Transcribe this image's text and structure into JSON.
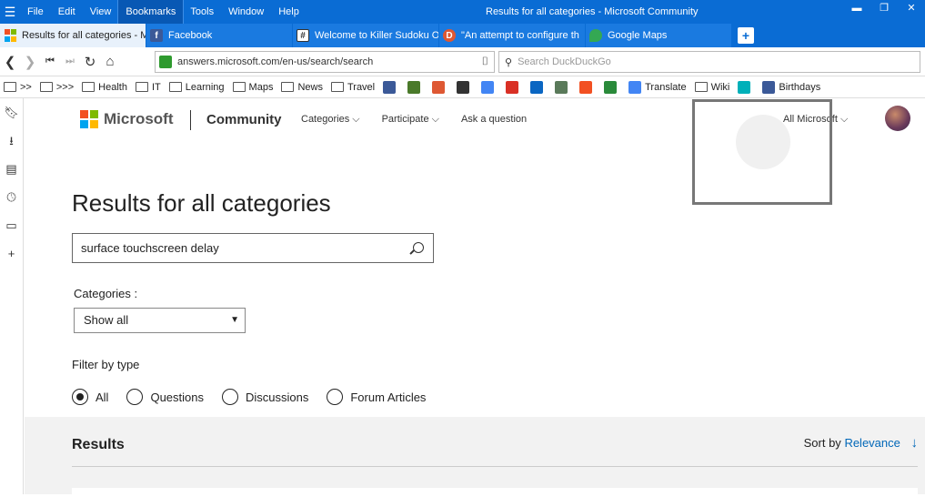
{
  "titlebar": {
    "menu": [
      "File",
      "Edit",
      "View",
      "Bookmarks",
      "Tools",
      "Window",
      "Help"
    ],
    "active_menu": "Bookmarks",
    "window_title": "Results for all categories - Microsoft Community"
  },
  "tabs": [
    {
      "label": "Results for all categories - M",
      "icon": "microsoft-icon",
      "active": true
    },
    {
      "label": "Facebook",
      "icon": "facebook-icon",
      "active": false
    },
    {
      "label": "Welcome to Killer Sudoku O",
      "icon": "sudoku-icon",
      "active": false
    },
    {
      "label": "\"An attempt to configure th",
      "icon": "duckduckgo-icon",
      "active": false
    },
    {
      "label": "Google Maps",
      "icon": "google-maps-icon",
      "active": false
    }
  ],
  "nav": {
    "url": "answers.microsoft.com/en-us/search/search",
    "search_placeholder": "Search DuckDuckGo"
  },
  "bookmarks": [
    {
      "label": ">>",
      "type": "folder"
    },
    {
      "label": ">>>",
      "type": "folder"
    },
    {
      "label": "Health",
      "type": "folder"
    },
    {
      "label": "IT",
      "type": "folder"
    },
    {
      "label": "Learning",
      "type": "folder"
    },
    {
      "label": "Maps",
      "type": "folder"
    },
    {
      "label": "News",
      "type": "folder"
    },
    {
      "label": "Travel",
      "type": "folder"
    },
    {
      "label": "",
      "type": "facebook-icon",
      "color": "#3b5998"
    },
    {
      "label": "",
      "type": "chess-icon",
      "color": "#4a7a2a"
    },
    {
      "label": "",
      "type": "duckduckgo-icon",
      "color": "#de5833"
    },
    {
      "label": "",
      "type": "notes-icon",
      "color": "#333333"
    },
    {
      "label": "",
      "type": "google-icon",
      "color": "#4285f4"
    },
    {
      "label": "",
      "type": "gmail-icon",
      "color": "#d93025"
    },
    {
      "label": "",
      "type": "linkedin-icon",
      "color": "#0a66c2"
    },
    {
      "label": "",
      "type": "photo-icon",
      "color": "#5a7a5a"
    },
    {
      "label": "",
      "type": "office-icon",
      "color": "#f25022"
    },
    {
      "label": "",
      "type": "tree-icon",
      "color": "#2a8a3a"
    },
    {
      "label": "Translate",
      "type": "translate-icon",
      "color": "#4285f4"
    },
    {
      "label": "Wiki",
      "type": "folder"
    },
    {
      "label": "",
      "type": "fitbit-icon",
      "color": "#00b0b9"
    },
    {
      "label": "Birthdays",
      "type": "facebook-icon",
      "color": "#3b5998"
    }
  ],
  "sidebar": [
    "bookmark-icon",
    "download-icon",
    "notes-icon",
    "history-icon",
    "window-icon",
    "add-icon"
  ],
  "site": {
    "brand": "Microsoft",
    "section": "Community",
    "nav": [
      "Categories ⌵",
      "Participate ⌵",
      "Ask a question"
    ],
    "all_ms": "All Microsoft ⌵"
  },
  "main": {
    "title": "Results for all categories",
    "query": "surface touchscreen delay",
    "categories_label": "Categories :",
    "category_selected": "Show all",
    "filter_label": "Filter by type",
    "filters": [
      {
        "label": "All",
        "checked": true
      },
      {
        "label": "Questions",
        "checked": false
      },
      {
        "label": "Discussions",
        "checked": false
      },
      {
        "label": "Forum Articles",
        "checked": false
      }
    ],
    "results_label": "Results",
    "sort_label": "Sort by",
    "sort_value": "Relevance"
  }
}
